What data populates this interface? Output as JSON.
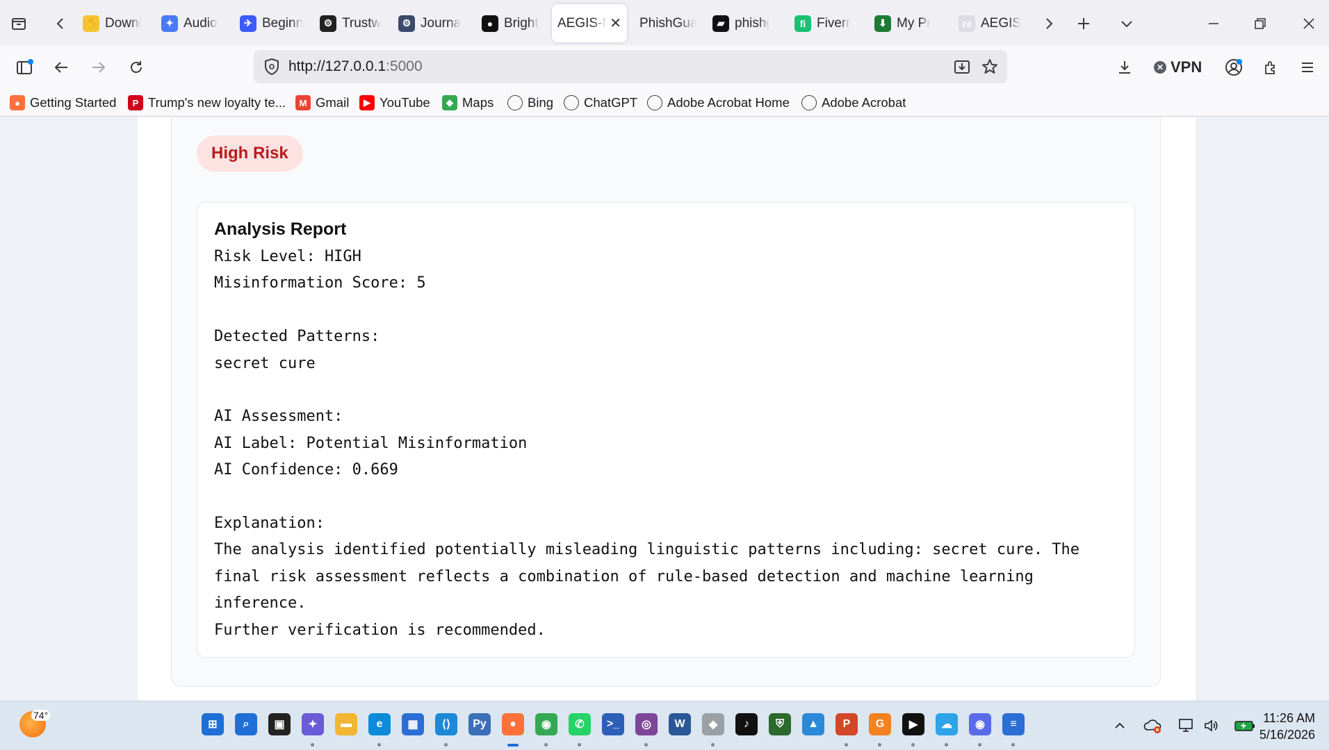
{
  "browser": {
    "tabs": [
      {
        "label": "Downl",
        "icon": "wave-hand-icon",
        "color": "#f4c430"
      },
      {
        "label": "Audio",
        "icon": "sparkle-icon",
        "color": "#4a7bf7"
      },
      {
        "label": "Beginn",
        "icon": "bird-icon",
        "color": "#3d5afe"
      },
      {
        "label": "Trustw",
        "icon": "openai-icon",
        "color": "#222222"
      },
      {
        "label": "Journa",
        "icon": "gear-icon",
        "color": "#3b4a6b"
      },
      {
        "label": "Bright",
        "icon": "github-icon",
        "color": "#111111"
      },
      {
        "label": "AEGIS-M",
        "icon": "",
        "color": "#ffffff",
        "active": true
      },
      {
        "label": "PhishGuar",
        "icon": "",
        "color": ""
      },
      {
        "label": "phishg",
        "icon": "brush-icon",
        "color": "#111111"
      },
      {
        "label": "Fiverr",
        "icon": "fiverr-icon",
        "color": "#1dbf73"
      },
      {
        "label": "My Pr",
        "icon": "download-box-icon",
        "color": "#1e7b34"
      },
      {
        "label": "AEGIS",
        "icon": "ze-icon",
        "color": "#dcdce2"
      }
    ],
    "url": "http://127.0.0.1",
    "url_port": ":5000",
    "vpn_label": "VPN",
    "bookmarks": [
      {
        "label": "Getting Started",
        "icon": "firefox-icon",
        "color": "#ff7139"
      },
      {
        "label": "Trump's new loyalty te...",
        "icon": "p-icon",
        "color": "#d0021b"
      },
      {
        "label": "Gmail",
        "icon": "gmail-icon",
        "color": "#ea4335"
      },
      {
        "label": "YouTube",
        "icon": "youtube-icon",
        "color": "#ff0000"
      },
      {
        "label": "Maps",
        "icon": "maps-icon",
        "color": "#34a853"
      },
      {
        "label": "Bing",
        "icon": "globe-icon",
        "color": ""
      },
      {
        "label": "ChatGPT",
        "icon": "openai-icon",
        "color": ""
      },
      {
        "label": "Adobe Acrobat Home",
        "icon": "globe-icon",
        "color": ""
      },
      {
        "label": "Adobe Acrobat",
        "icon": "globe-icon",
        "color": ""
      }
    ]
  },
  "page": {
    "risk_badge": "High Risk",
    "report_title": "Analysis Report",
    "report_body": "Risk Level: HIGH\nMisinformation Score: 5\n\nDetected Patterns:\nsecret cure\n\nAI Assessment:\nAI Label: Potential Misinformation\nAI Confidence: 0.669\n\nExplanation:\nThe analysis identified potentially misleading linguistic patterns including: secret cure. The\nfinal risk assessment reflects a combination of rule-based detection and machine learning\ninference.\nFurther verification is recommended."
  },
  "taskbar": {
    "weather_temp": "74°",
    "apps": [
      {
        "name": "windows-start",
        "color": "#1f6fd6",
        "glyph": "⊞"
      },
      {
        "name": "search",
        "color": "#1f6fd6",
        "glyph": "⌕"
      },
      {
        "name": "task-view",
        "color": "#222222",
        "glyph": "▣"
      },
      {
        "name": "copilot",
        "color": "#6b5bd6",
        "glyph": "✦"
      },
      {
        "name": "file-explorer",
        "color": "#f2b632",
        "glyph": "▬"
      },
      {
        "name": "edge",
        "color": "#0c8bd8",
        "glyph": "e"
      },
      {
        "name": "store",
        "color": "#2b6fd6",
        "glyph": "▦"
      },
      {
        "name": "vscode",
        "color": "#1c8ad8",
        "glyph": "⟨⟩"
      },
      {
        "name": "python",
        "color": "#3b6fb6",
        "glyph": "Py"
      },
      {
        "name": "firefox",
        "color": "#ff7139",
        "glyph": "●"
      },
      {
        "name": "chrome",
        "color": "#34a853",
        "glyph": "◉"
      },
      {
        "name": "whatsapp",
        "color": "#25d366",
        "glyph": "✆"
      },
      {
        "name": "powershell",
        "color": "#2d5fb8",
        "glyph": ">_"
      },
      {
        "name": "tor",
        "color": "#7d4698",
        "glyph": "◎"
      },
      {
        "name": "word",
        "color": "#2b5797",
        "glyph": "W"
      },
      {
        "name": "app-gray",
        "color": "#9aa0a6",
        "glyph": "◆"
      },
      {
        "name": "tiktok",
        "color": "#111111",
        "glyph": "♪"
      },
      {
        "name": "shield-app",
        "color": "#2d6a2d",
        "glyph": "⛨"
      },
      {
        "name": "photos",
        "color": "#2b8ad8",
        "glyph": "▲"
      },
      {
        "name": "powerpoint",
        "color": "#d24726",
        "glyph": "P"
      },
      {
        "name": "orange-app",
        "color": "#f58220",
        "glyph": "G"
      },
      {
        "name": "media-player",
        "color": "#111111",
        "glyph": "▶"
      },
      {
        "name": "cloud-files",
        "color": "#2ea3e8",
        "glyph": "☁"
      },
      {
        "name": "chat-app",
        "color": "#5b6be8",
        "glyph": "◉"
      },
      {
        "name": "notepad",
        "color": "#2b6fd6",
        "glyph": "≡"
      }
    ],
    "time": "11:26 AM",
    "date": "5/16/2026"
  }
}
